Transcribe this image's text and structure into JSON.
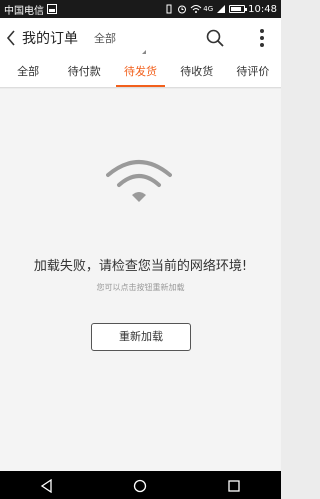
{
  "status_bar": {
    "carrier": "中国电信",
    "network": "4G",
    "time": "10:48"
  },
  "header": {
    "title": "我的订单",
    "filter": "全部"
  },
  "tabs": [
    {
      "label": "全部"
    },
    {
      "label": "待付款"
    },
    {
      "label": "待发货"
    },
    {
      "label": "待收货"
    },
    {
      "label": "待评价"
    }
  ],
  "active_tab": "待发货",
  "error": {
    "title": "加载失败，请检查您当前的网络环境!",
    "subtitle": "您可以点击按钮重新加载",
    "reload_label": "重新加载"
  },
  "colors": {
    "accent": "#f2601c",
    "status_bar": "#1a1a1a",
    "nav_bar": "#000000"
  },
  "icons": {
    "back": "chevron-left-icon",
    "search": "search-icon",
    "more": "more-vertical-icon",
    "wifi": "wifi-icon",
    "nav_back": "triangle-back-icon",
    "nav_home": "circle-home-icon",
    "nav_recent": "square-recent-icon"
  }
}
